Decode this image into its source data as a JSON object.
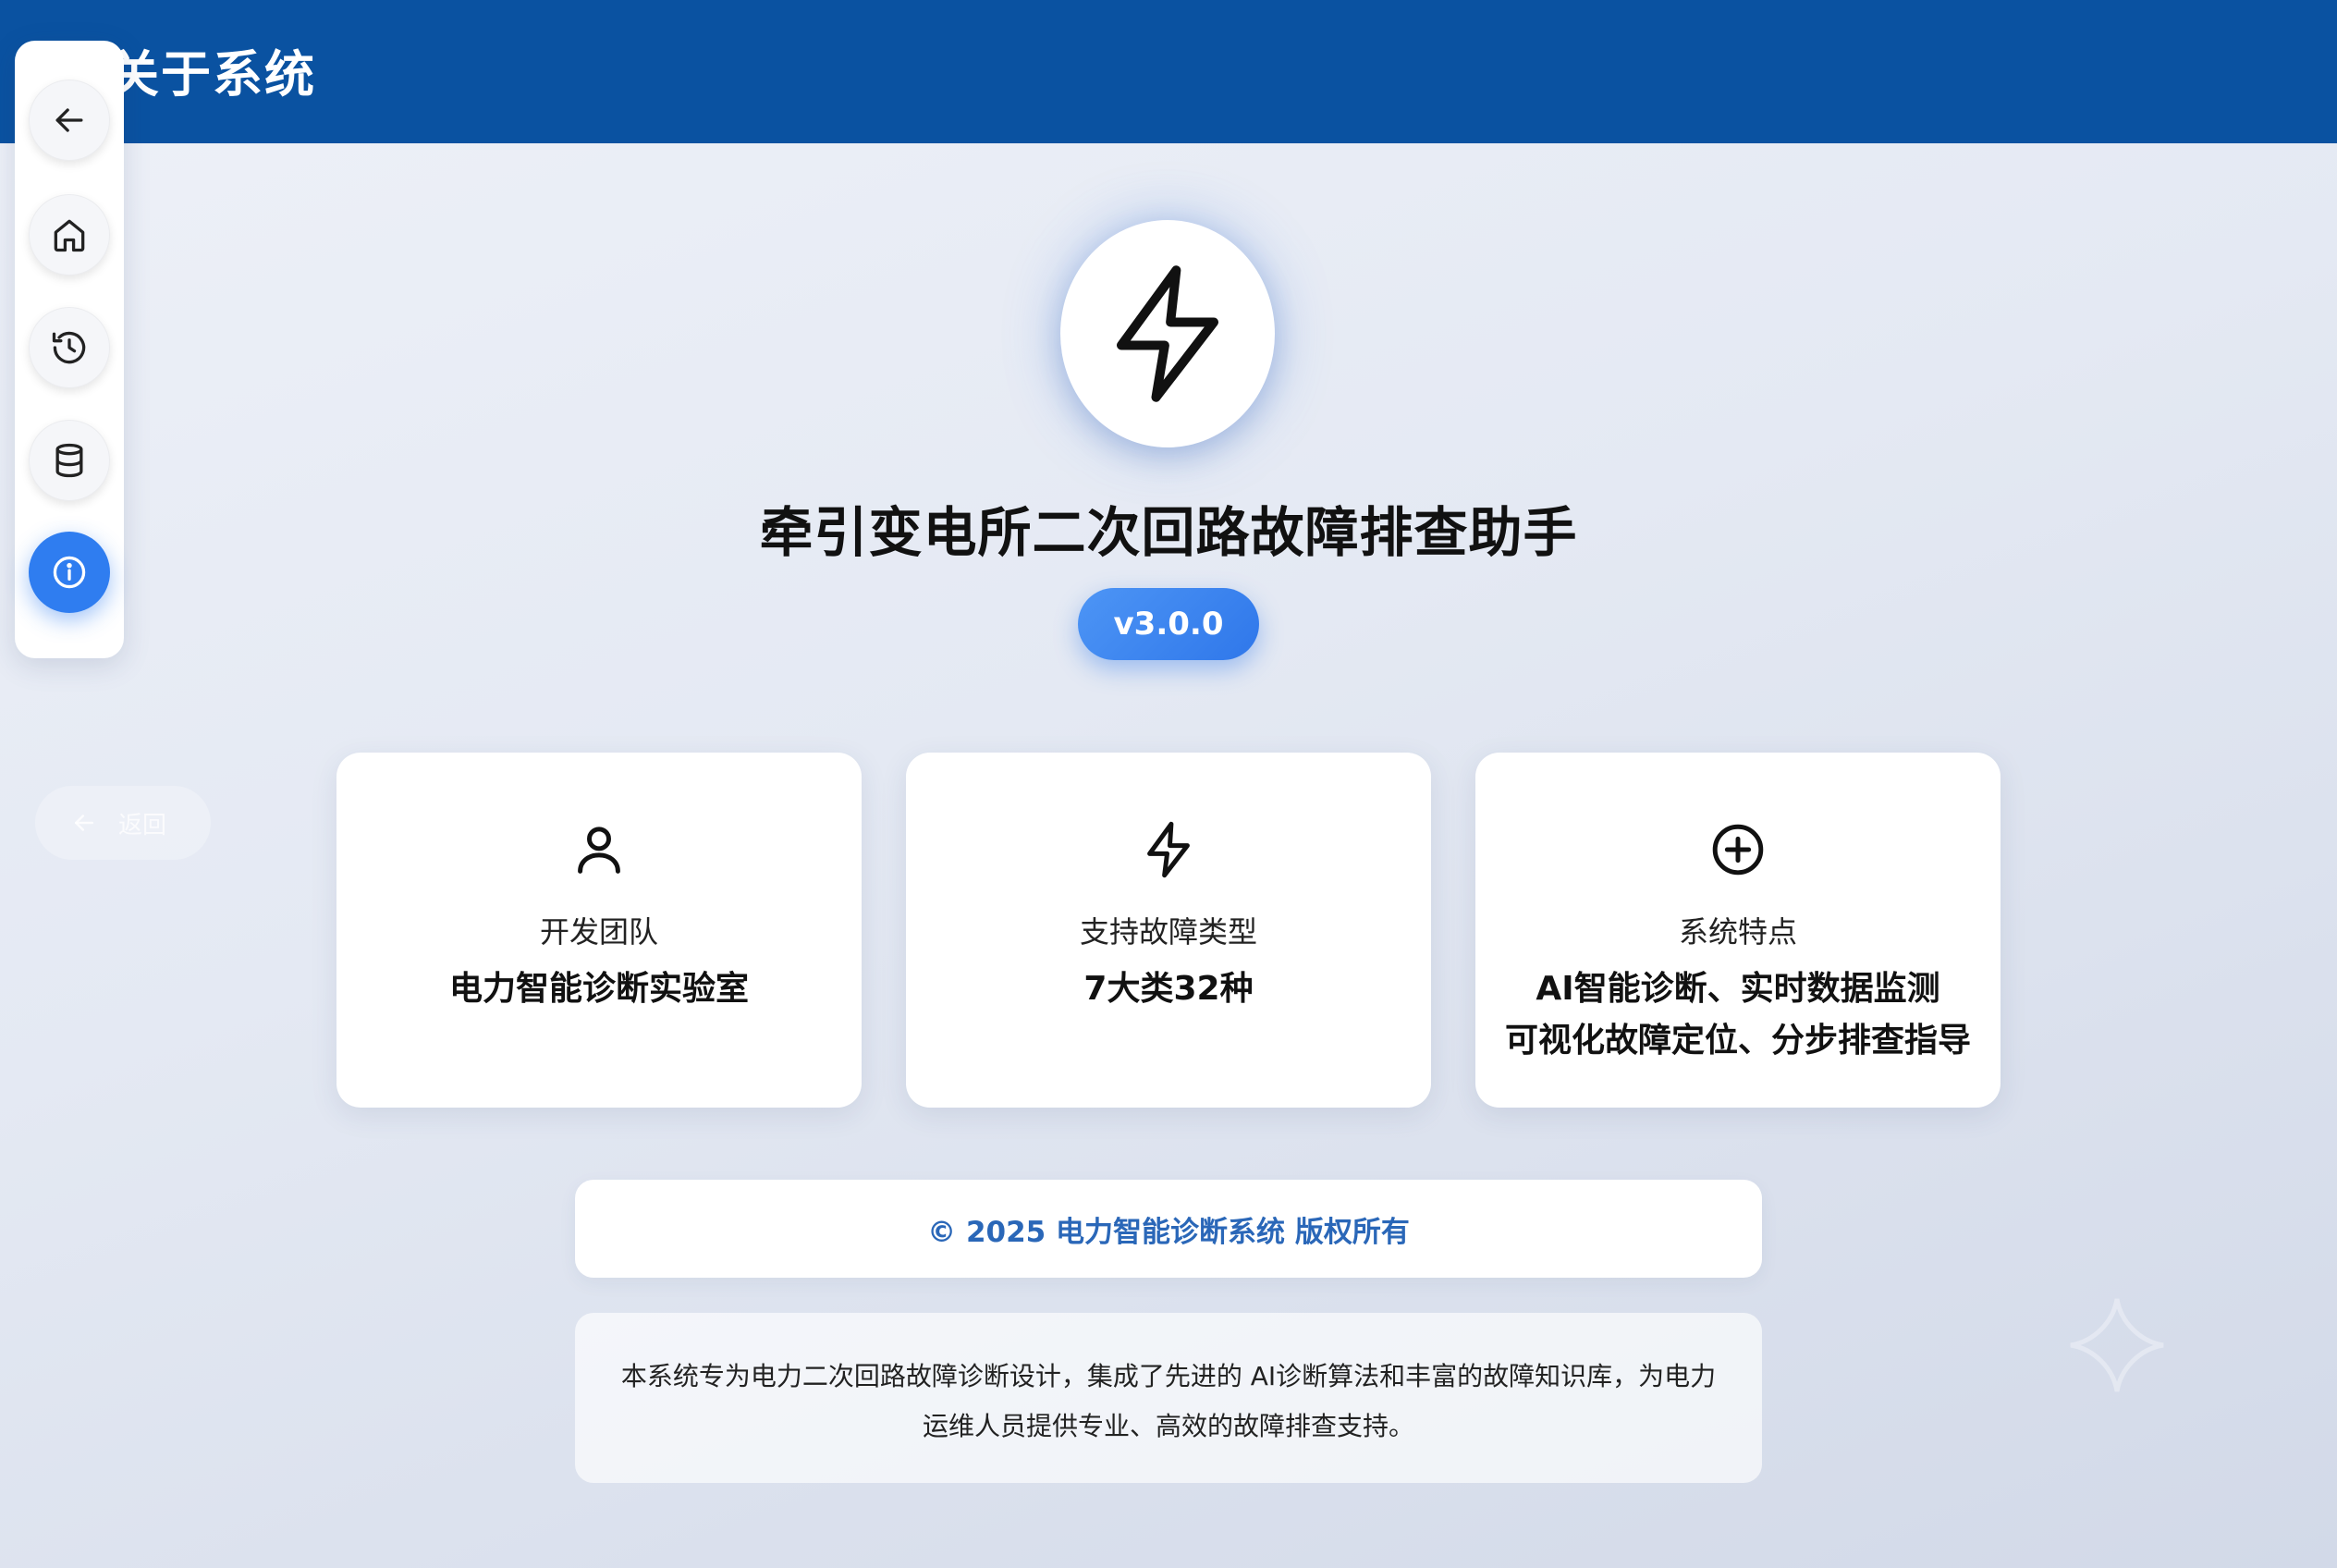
{
  "header": {
    "title": "关于系统"
  },
  "nav": {
    "items": [
      {
        "icon": "arrow-left-icon",
        "active": false
      },
      {
        "icon": "home-icon",
        "active": false
      },
      {
        "icon": "history-icon",
        "active": false
      },
      {
        "icon": "database-icon",
        "active": false
      },
      {
        "icon": "info-icon",
        "active": true
      }
    ]
  },
  "back_link": {
    "label": "返回",
    "icon": "arrow-left-icon"
  },
  "hero": {
    "logo_icon": "lightning-icon",
    "title": "牵引变电所二次回路故障排查助手",
    "version": "v3.0.0"
  },
  "cards": [
    {
      "icon": "user-icon",
      "label": "开发团队",
      "value": "电力智能诊断实验室"
    },
    {
      "icon": "lightning-icon",
      "label": "支持故障类型",
      "value": "7大类32种"
    },
    {
      "icon": "plus-circle-icon",
      "label": "系统特点",
      "value_lines": [
        "AI智能诊断、实时数据监测",
        "可视化故障定位、分步排查指导"
      ]
    }
  ],
  "copyright": "© 2025 电力智能诊断系统 版权所有",
  "description": "本系统专为电力二次回路故障诊断设计，集成了先进的 AI诊断算法和丰富的故障知识库，为电力运维人员提供专业、高效的故障排查支持。",
  "colors": {
    "header_bg": "#0a52a1",
    "accent": "#2f7df0",
    "copyright_text": "#2a67b8"
  }
}
